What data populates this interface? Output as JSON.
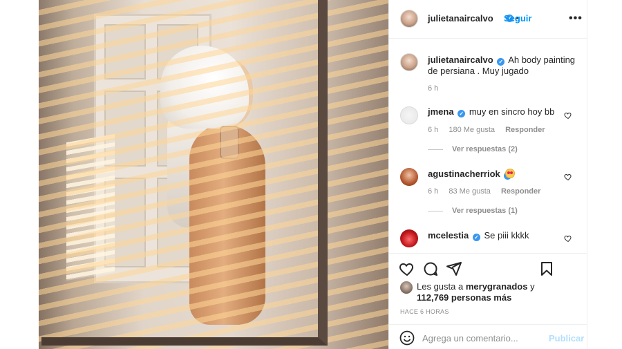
{
  "post": {
    "author": "julietanaircalvo",
    "follow_label": "Seguir",
    "separator": "•",
    "more_label": "•••",
    "verified_mark": "✓"
  },
  "caption": {
    "username": "julietanaircalvo",
    "text": "Ah body painting de persiana . Muy jugado",
    "time": "6 h"
  },
  "comments": [
    {
      "username": "jmena",
      "text": "muy en sincro hoy bb",
      "time": "6 h",
      "likes": "180 Me gusta",
      "reply_label": "Responder",
      "view_replies": "Ver respuestas (2)"
    },
    {
      "username": "agustinacherriok",
      "text": "",
      "emoji": "heart-eyes-emoji",
      "time": "6 h",
      "likes": "83 Me gusta",
      "reply_label": "Responder",
      "view_replies": "Ver respuestas (1)"
    },
    {
      "username": "mcelestia",
      "text": "Se piii kkkk"
    }
  ],
  "likes": {
    "prefix": "Les gusta a",
    "user": "merygranados",
    "conjunction": "y",
    "count": "112,769 personas más"
  },
  "timestamp": "HACE 6 HORAS",
  "comment_box": {
    "placeholder": "Agrega un comentario...",
    "publish_label": "Publicar"
  },
  "icons": [
    "heart-icon",
    "comment-icon",
    "share-icon",
    "bookmark-icon",
    "emoji-icon",
    "verified-icon",
    "small-heart-icon"
  ],
  "colors": {
    "link_blue": "#0095f6",
    "verified_blue": "#3897f0",
    "muted": "#8e8e8e",
    "publish_disabled": "#b2dffc"
  }
}
